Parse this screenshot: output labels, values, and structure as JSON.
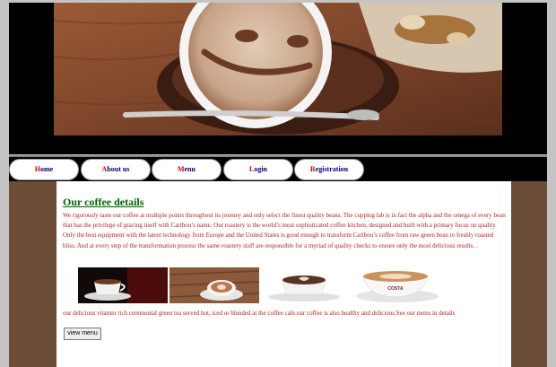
{
  "nav": {
    "items": [
      {
        "first": "H",
        "rest": "ome"
      },
      {
        "first": "A",
        "rest": "bout us"
      },
      {
        "first": "M",
        "rest": "enu"
      },
      {
        "first": "L",
        "rest": "ogin"
      },
      {
        "first": "R",
        "rest": "egistration"
      }
    ]
  },
  "main": {
    "heading": "Our coffee details",
    "intro": "We rigorously taste our coffee at multiple points throughout its journey and only select the finest quality beans. The cupping lab is in fact the alpha and the omega of every bean that has the privilege of gracing itself with Caribou’s name. Our roastery is the world’s most sophisticated coffee kitchen, designed and built with a primary focus on quality. Only the best equipment with the latest technology from Europe and the United States is good enough to transform Caribou’s coffee from raw green bean to freshly roasted bliss. And at every step of the transformation process the same roastery staff are responsible for a myriad of quality checks to ensure only the most delicious results. .",
    "details": "our delicious vitamin rich ceremonial green tea served hot, iced or blended at the coffee cafe.our coffee is also healthy and delicious.See our menu in details",
    "view_menu_label": "view menu",
    "cup_brand": "COSTA"
  },
  "colors": {
    "header_bg": "#000000",
    "content_bg": "#6b4c36",
    "heading": "#006400",
    "text": "#b22222",
    "nav_text": "#000080",
    "nav_first_letter": "#d00000"
  }
}
